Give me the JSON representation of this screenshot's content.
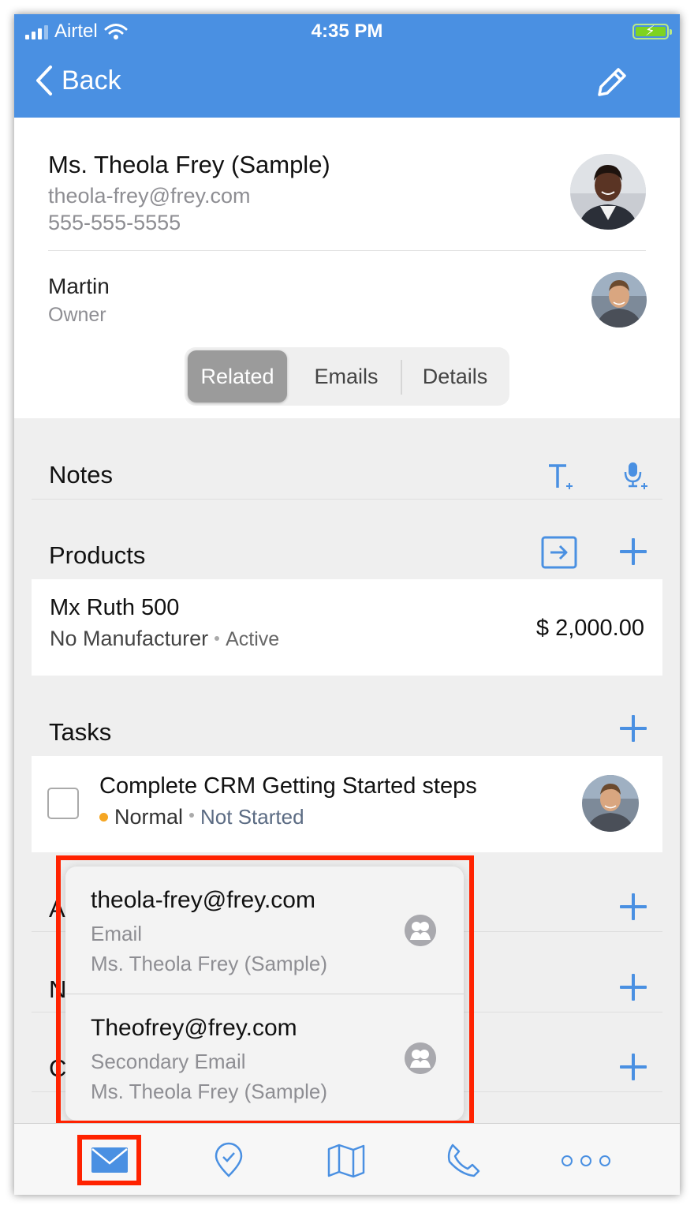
{
  "status_bar": {
    "carrier": "Airtel",
    "time": "4:35 PM"
  },
  "nav": {
    "back_label": "Back"
  },
  "contact": {
    "name": "Ms. Theola Frey (Sample)",
    "email": "theola-frey@frey.com",
    "phone": "555-555-5555"
  },
  "owner": {
    "name": "Martin",
    "role": "Owner"
  },
  "segments": {
    "items": [
      "Related",
      "Emails",
      "Details"
    ],
    "selected": "Related"
  },
  "sections": {
    "notes": {
      "title": "Notes"
    },
    "products": {
      "title": "Products",
      "item": {
        "name": "Mx Ruth 500",
        "manufacturer": "No Manufacturer",
        "status": "Active",
        "price": "$ 2,000.00"
      }
    },
    "tasks": {
      "title": "Tasks",
      "item": {
        "title": "Complete CRM Getting Started steps",
        "priority": "Normal",
        "status": "Not Started"
      }
    },
    "hidden_rows": [
      "A",
      "N",
      "C"
    ]
  },
  "email_picker": {
    "options": [
      {
        "address": "theola-frey@frey.com",
        "type": "Email",
        "contact": "Ms. Theola Frey (Sample)"
      },
      {
        "address": "Theofrey@frey.com",
        "type": "Secondary Email",
        "contact": "Ms. Theola Frey (Sample)"
      }
    ]
  },
  "tab_bar": {
    "items": [
      "mail-icon",
      "location-pin-icon",
      "map-icon",
      "phone-icon",
      "more-icon"
    ],
    "highlighted": "mail-icon"
  },
  "colors": {
    "accent": "#4a90e2",
    "highlight": "#ff2200",
    "priority_dot": "#f5a623"
  }
}
